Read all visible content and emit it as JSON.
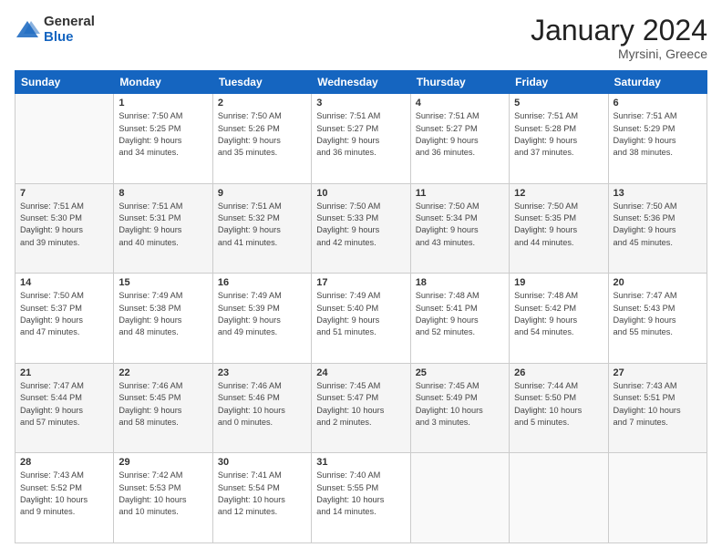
{
  "logo": {
    "general": "General",
    "blue": "Blue"
  },
  "title": {
    "month_year": "January 2024",
    "location": "Myrsini, Greece"
  },
  "weekdays": [
    "Sunday",
    "Monday",
    "Tuesday",
    "Wednesday",
    "Thursday",
    "Friday",
    "Saturday"
  ],
  "weeks": [
    [
      {
        "day": "",
        "info": ""
      },
      {
        "day": "1",
        "info": "Sunrise: 7:50 AM\nSunset: 5:25 PM\nDaylight: 9 hours\nand 34 minutes."
      },
      {
        "day": "2",
        "info": "Sunrise: 7:50 AM\nSunset: 5:26 PM\nDaylight: 9 hours\nand 35 minutes."
      },
      {
        "day": "3",
        "info": "Sunrise: 7:51 AM\nSunset: 5:27 PM\nDaylight: 9 hours\nand 36 minutes."
      },
      {
        "day": "4",
        "info": "Sunrise: 7:51 AM\nSunset: 5:27 PM\nDaylight: 9 hours\nand 36 minutes."
      },
      {
        "day": "5",
        "info": "Sunrise: 7:51 AM\nSunset: 5:28 PM\nDaylight: 9 hours\nand 37 minutes."
      },
      {
        "day": "6",
        "info": "Sunrise: 7:51 AM\nSunset: 5:29 PM\nDaylight: 9 hours\nand 38 minutes."
      }
    ],
    [
      {
        "day": "7",
        "info": "Sunrise: 7:51 AM\nSunset: 5:30 PM\nDaylight: 9 hours\nand 39 minutes."
      },
      {
        "day": "8",
        "info": "Sunrise: 7:51 AM\nSunset: 5:31 PM\nDaylight: 9 hours\nand 40 minutes."
      },
      {
        "day": "9",
        "info": "Sunrise: 7:51 AM\nSunset: 5:32 PM\nDaylight: 9 hours\nand 41 minutes."
      },
      {
        "day": "10",
        "info": "Sunrise: 7:50 AM\nSunset: 5:33 PM\nDaylight: 9 hours\nand 42 minutes."
      },
      {
        "day": "11",
        "info": "Sunrise: 7:50 AM\nSunset: 5:34 PM\nDaylight: 9 hours\nand 43 minutes."
      },
      {
        "day": "12",
        "info": "Sunrise: 7:50 AM\nSunset: 5:35 PM\nDaylight: 9 hours\nand 44 minutes."
      },
      {
        "day": "13",
        "info": "Sunrise: 7:50 AM\nSunset: 5:36 PM\nDaylight: 9 hours\nand 45 minutes."
      }
    ],
    [
      {
        "day": "14",
        "info": "Sunrise: 7:50 AM\nSunset: 5:37 PM\nDaylight: 9 hours\nand 47 minutes."
      },
      {
        "day": "15",
        "info": "Sunrise: 7:49 AM\nSunset: 5:38 PM\nDaylight: 9 hours\nand 48 minutes."
      },
      {
        "day": "16",
        "info": "Sunrise: 7:49 AM\nSunset: 5:39 PM\nDaylight: 9 hours\nand 49 minutes."
      },
      {
        "day": "17",
        "info": "Sunrise: 7:49 AM\nSunset: 5:40 PM\nDaylight: 9 hours\nand 51 minutes."
      },
      {
        "day": "18",
        "info": "Sunrise: 7:48 AM\nSunset: 5:41 PM\nDaylight: 9 hours\nand 52 minutes."
      },
      {
        "day": "19",
        "info": "Sunrise: 7:48 AM\nSunset: 5:42 PM\nDaylight: 9 hours\nand 54 minutes."
      },
      {
        "day": "20",
        "info": "Sunrise: 7:47 AM\nSunset: 5:43 PM\nDaylight: 9 hours\nand 55 minutes."
      }
    ],
    [
      {
        "day": "21",
        "info": "Sunrise: 7:47 AM\nSunset: 5:44 PM\nDaylight: 9 hours\nand 57 minutes."
      },
      {
        "day": "22",
        "info": "Sunrise: 7:46 AM\nSunset: 5:45 PM\nDaylight: 9 hours\nand 58 minutes."
      },
      {
        "day": "23",
        "info": "Sunrise: 7:46 AM\nSunset: 5:46 PM\nDaylight: 10 hours\nand 0 minutes."
      },
      {
        "day": "24",
        "info": "Sunrise: 7:45 AM\nSunset: 5:47 PM\nDaylight: 10 hours\nand 2 minutes."
      },
      {
        "day": "25",
        "info": "Sunrise: 7:45 AM\nSunset: 5:49 PM\nDaylight: 10 hours\nand 3 minutes."
      },
      {
        "day": "26",
        "info": "Sunrise: 7:44 AM\nSunset: 5:50 PM\nDaylight: 10 hours\nand 5 minutes."
      },
      {
        "day": "27",
        "info": "Sunrise: 7:43 AM\nSunset: 5:51 PM\nDaylight: 10 hours\nand 7 minutes."
      }
    ],
    [
      {
        "day": "28",
        "info": "Sunrise: 7:43 AM\nSunset: 5:52 PM\nDaylight: 10 hours\nand 9 minutes."
      },
      {
        "day": "29",
        "info": "Sunrise: 7:42 AM\nSunset: 5:53 PM\nDaylight: 10 hours\nand 10 minutes."
      },
      {
        "day": "30",
        "info": "Sunrise: 7:41 AM\nSunset: 5:54 PM\nDaylight: 10 hours\nand 12 minutes."
      },
      {
        "day": "31",
        "info": "Sunrise: 7:40 AM\nSunset: 5:55 PM\nDaylight: 10 hours\nand 14 minutes."
      },
      {
        "day": "",
        "info": ""
      },
      {
        "day": "",
        "info": ""
      },
      {
        "day": "",
        "info": ""
      }
    ]
  ]
}
